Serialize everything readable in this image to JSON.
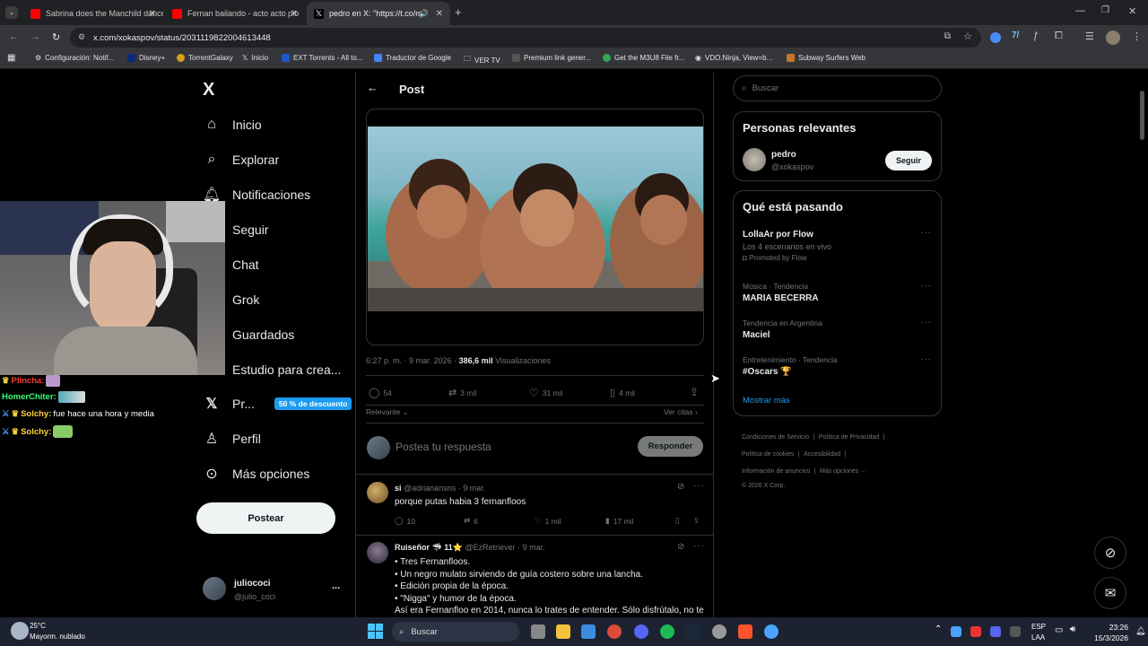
{
  "browser": {
    "tabs": [
      {
        "title": "Sabrina does the Manchild dance"
      },
      {
        "title": "Fernan bailando - acto acto pio"
      },
      {
        "title": "pedro en X: \"https://t.co/m"
      }
    ],
    "new_tab": "+",
    "url": "x.com/xokaspov/status/2031119822004613448",
    "bookmarks": [
      "Configuración: Notif...",
      "Disney+",
      "TorrentGalaxy",
      "Inicio",
      "EXT Torrents - All to...",
      "Traductor de Google",
      "VER TV",
      "Premium link gener...",
      "Get the M3U8 File fr...",
      "VDO.Ninja, View=b...",
      "Subway Surfers Web"
    ]
  },
  "sidebar": {
    "logo": "X",
    "items": [
      {
        "label": "Inicio",
        "icon": "home-icon"
      },
      {
        "label": "Explorar",
        "icon": "search-icon"
      },
      {
        "label": "Notificaciones",
        "icon": "bell-icon"
      },
      {
        "label": "Seguir",
        "icon": "people-icon"
      },
      {
        "label": "Chat",
        "icon": "chat-icon"
      },
      {
        "label": "Grok",
        "icon": "grok-icon"
      },
      {
        "label": "Guardados",
        "icon": "bookmark-icon"
      },
      {
        "label": "Estudio para crea...",
        "icon": "studio-icon"
      },
      {
        "label": "Pr...",
        "icon": "x-icon"
      },
      {
        "label": "Perfil",
        "icon": "person-icon"
      },
      {
        "label": "Más opciones",
        "icon": "more-icon"
      }
    ],
    "premium_badge": "50 % de descuento",
    "post_button": "Postear",
    "account": {
      "name": "juliococi",
      "handle": "@julio_coci",
      "more": "..."
    }
  },
  "main": {
    "header_title": "Post",
    "meta": {
      "time": "6:27 p. m. · 9 mar. 2026 · ",
      "views_count": "386,6 mil",
      "views_label": " Visualizaciones"
    },
    "stats": {
      "replies": "54",
      "reposts": "3 mil",
      "likes": "31 mil",
      "bookmarks": "4 mil"
    },
    "sort_label": "Relevante",
    "quotes_label": "Ver citas",
    "reply_placeholder": "Postea tu respuesta",
    "reply_button": "Responder",
    "replies": [
      {
        "name": "si",
        "handle": "@adrianansns",
        "date": "· 9 mar.",
        "text": "porque putas habia 3 fernanfloos",
        "replies": "10",
        "reposts": "6",
        "likes": "1 mil",
        "views": "17 mil"
      },
      {
        "name": "Ruiseñor",
        "badge": "🦈 11⭐",
        "handle": "@EzRetriever",
        "date": "· 9 mar.",
        "lines": [
          "• Tres Fernanfloos.",
          "• Un negro mulato sirviendo de guía costero sobre una lancha.",
          "• Edición propia de la época.",
          "• \"Nigga\" y humor de la época.",
          "Así era Fernanfloo en 2014, nunca lo trates de entender. Sólo disfrútalo, no te"
        ]
      }
    ]
  },
  "right": {
    "search_placeholder": "Buscar",
    "relevant_title": "Personas relevantes",
    "relevant_person": {
      "name": "pedro",
      "handle": "@xokaspov",
      "follow": "Seguir"
    },
    "trending_title": "Qué está pasando",
    "trends": [
      {
        "name": "LollaAr por Flow",
        "sub": "Los 4 escenarios en vivo",
        "promo": "Promoted by Flow"
      },
      {
        "cat": "Música · Tendencia",
        "name": "MARIA BECERRA"
      },
      {
        "cat": "Tendencia en Argentina",
        "name": "Maciel"
      },
      {
        "cat": "Entretenimiento · Tendencia",
        "name": "#Oscars 🏆"
      }
    ],
    "show_more": "Mostrar más",
    "footer": [
      "Condiciones de Servicio",
      "Política de Privacidad",
      "Política de cookies",
      "Accesibilidad",
      "Información de anuncios",
      "Más opciones ···",
      "© 2026 X Corp."
    ]
  },
  "stream_chat": [
    {
      "user": "Plincha:",
      "color": "#ff3b3b"
    },
    {
      "user": "HomerChiter:",
      "color": "#3bff7a"
    },
    {
      "user": "Solchy:",
      "color": "#ffd23b",
      "text": "fue hace una hora y media"
    },
    {
      "user": "Solchy:",
      "color": "#ffd23b"
    }
  ],
  "taskbar": {
    "weather_temp": "25°C",
    "weather_desc": "Mayorm. nublado",
    "search": "Buscar",
    "lang": "ESP",
    "lang2": "LAA",
    "time": "23:26",
    "date": "15/3/2026"
  }
}
